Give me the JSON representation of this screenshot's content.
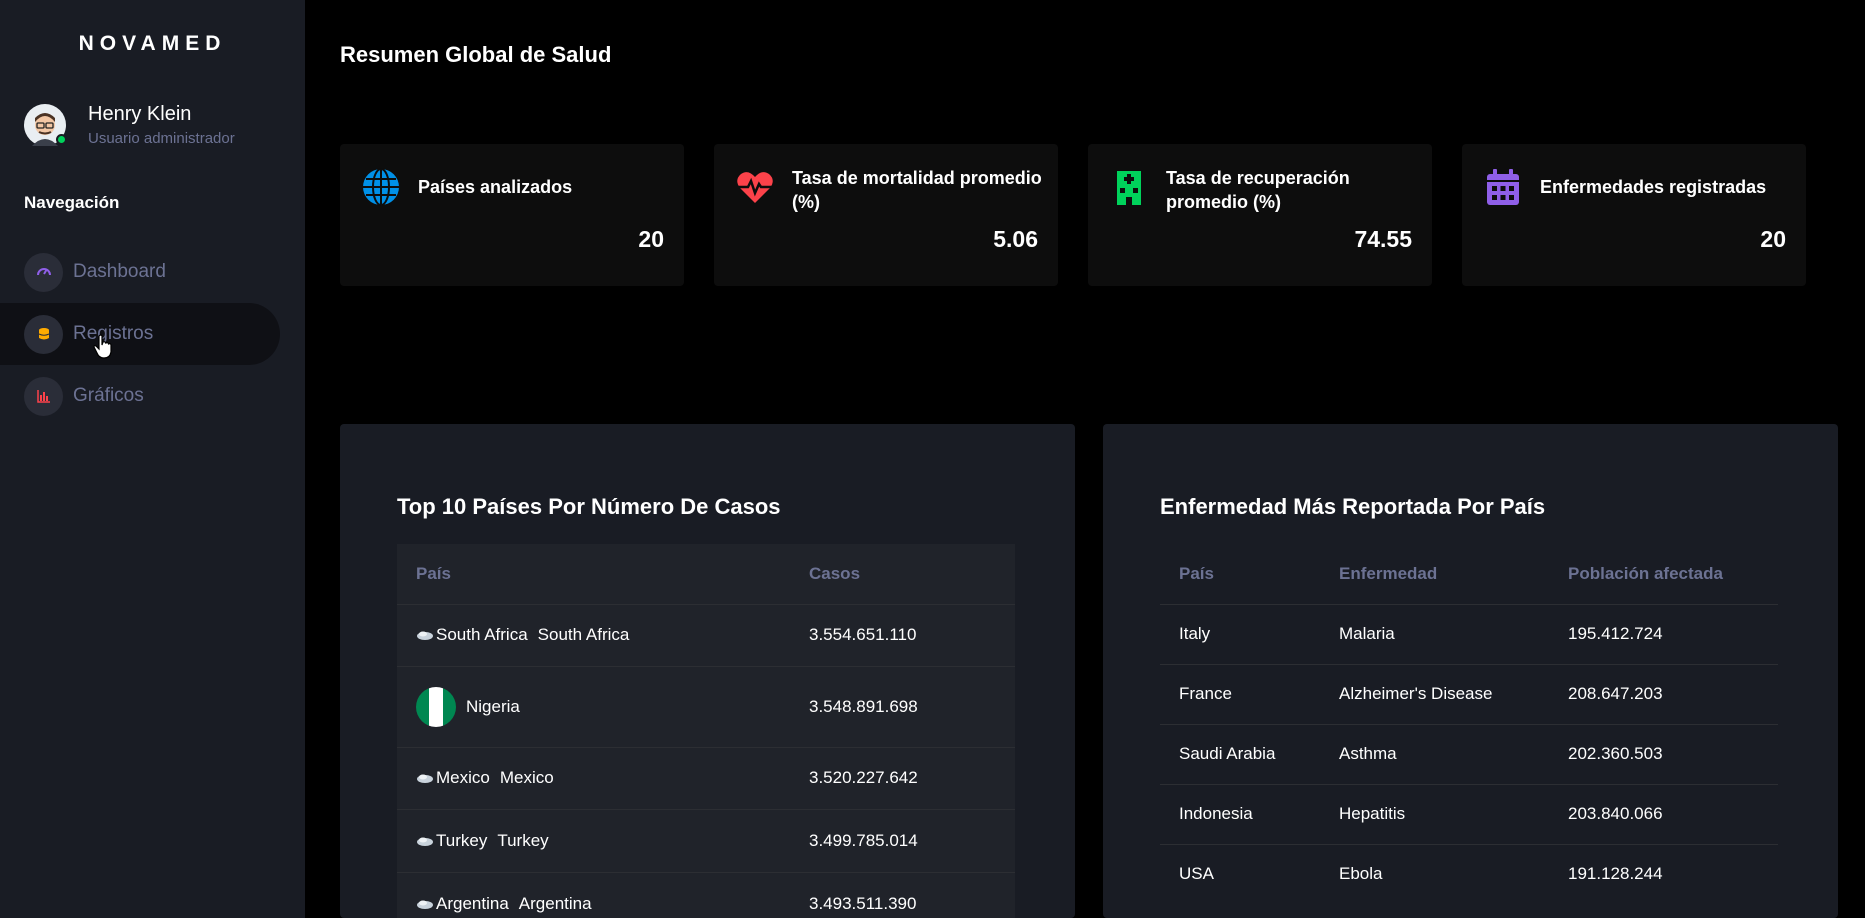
{
  "brand": "NOVAMED",
  "user": {
    "name": "Henry Klein",
    "role": "Usuario administrador"
  },
  "nav": {
    "title": "Navegación",
    "items": [
      {
        "label": "Dashboard",
        "icon": "speedometer-icon",
        "color": "#8f5fe8"
      },
      {
        "label": "Registros",
        "icon": "database-icon",
        "color": "#ffab00"
      },
      {
        "label": "Gráficos",
        "icon": "chart-bar-icon",
        "color": "#fc424a"
      }
    ]
  },
  "main": {
    "title": "Resumen Global de Salud",
    "cards": [
      {
        "label": "Países analizados",
        "value": "20",
        "icon": "globe-icon",
        "color": "#0090e7"
      },
      {
        "label": "Tasa de mortalidad promedio (%)",
        "value": "5.06",
        "icon": "heart-pulse-icon",
        "color": "#fc424a"
      },
      {
        "label": "Tasa de recuperación promedio (%)",
        "value": "74.55",
        "icon": "hospital-icon",
        "color": "#00d25b"
      },
      {
        "label": "Enfermedades registradas",
        "value": "20",
        "icon": "calendar-icon",
        "color": "#8f5fe8"
      }
    ]
  },
  "top_countries": {
    "title": "Top 10 Países Por Número De Casos",
    "headers": [
      "País",
      "Casos"
    ],
    "rows": [
      {
        "flag_alt": "South Africa",
        "country": "South Africa",
        "cases": "3.554.651.110"
      },
      {
        "flag_alt": "",
        "country": "Nigeria",
        "cases": "3.548.891.698"
      },
      {
        "flag_alt": "Mexico",
        "country": "Mexico",
        "cases": "3.520.227.642"
      },
      {
        "flag_alt": "Turkey",
        "country": "Turkey",
        "cases": "3.499.785.014"
      },
      {
        "flag_alt": "Argentina",
        "country": "Argentina",
        "cases": "3.493.511.390"
      }
    ]
  },
  "disease_by_country": {
    "title": "Enfermedad Más Reportada Por País",
    "headers": [
      "País",
      "Enfermedad",
      "Población afectada"
    ],
    "rows": [
      {
        "country": "Italy",
        "disease": "Malaria",
        "population": "195.412.724"
      },
      {
        "country": "France",
        "disease": "Alzheimer's Disease",
        "population": "208.647.203"
      },
      {
        "country": "Saudi Arabia",
        "disease": "Asthma",
        "population": "202.360.503"
      },
      {
        "country": "Indonesia",
        "disease": "Hepatitis",
        "population": "203.840.066"
      },
      {
        "country": "USA",
        "disease": "Ebola",
        "population": "191.128.244"
      }
    ]
  }
}
